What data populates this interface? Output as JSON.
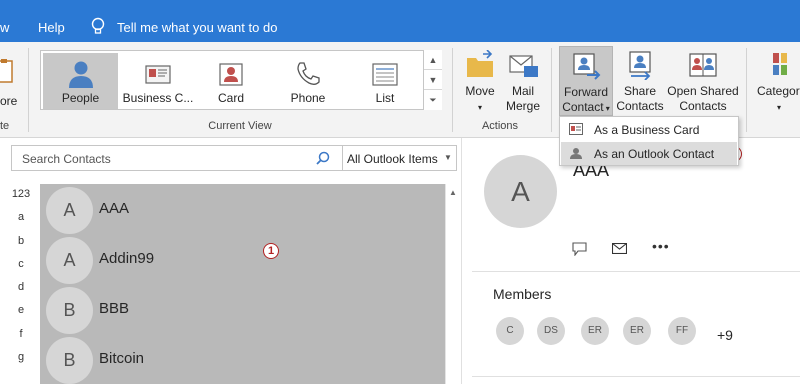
{
  "topbar": {
    "tab_partial": "w",
    "help": "Help",
    "tell_me": "Tell me what you want to do"
  },
  "ribbon": {
    "left_partial_label": "ore",
    "left_group_partial": "te",
    "views": [
      {
        "label": "People",
        "icon": "person-icon",
        "selected": true
      },
      {
        "label": "Business C...",
        "icon": "business-card-icon",
        "selected": false
      },
      {
        "label": "Card",
        "icon": "contact-card-icon",
        "selected": false
      },
      {
        "label": "Phone",
        "icon": "phone-icon",
        "selected": false
      },
      {
        "label": "List",
        "icon": "list-icon",
        "selected": false
      }
    ],
    "current_view_label": "Current View",
    "move": "Move",
    "mail_merge": [
      "Mail",
      "Merge"
    ],
    "actions_label": "Actions",
    "forward_contact": [
      "Forward",
      "Contact"
    ],
    "share_contacts": [
      "Share",
      "Contacts"
    ],
    "open_shared_contacts": [
      "Open Shared",
      "Contacts"
    ],
    "categorize_partial": "Categor"
  },
  "menu": {
    "business_card": "As a Business Card",
    "outlook_contact": "As an Outlook Contact"
  },
  "annotations": {
    "step1": "1",
    "step2": "2"
  },
  "search": {
    "placeholder": "Search Contacts",
    "scope": "All Outlook Items"
  },
  "index_letters": [
    "123",
    "a",
    "b",
    "c",
    "d",
    "e",
    "f",
    "g"
  ],
  "contacts": [
    {
      "initial": "A",
      "name": "AAA"
    },
    {
      "initial": "A",
      "name": "Addin99"
    },
    {
      "initial": "B",
      "name": "BBB"
    },
    {
      "initial": "B",
      "name": "Bitcoin"
    }
  ],
  "detail": {
    "initial": "A",
    "name": "AAA",
    "members_label": "Members",
    "members": [
      "C",
      "DS",
      "ER",
      "ER",
      "FF"
    ],
    "more_count": "+9"
  },
  "colors": {
    "topbar": "#2b79d4",
    "ribbon": "#f3f3f3",
    "selection": "#b9b9b9",
    "badge": "#b22222"
  }
}
